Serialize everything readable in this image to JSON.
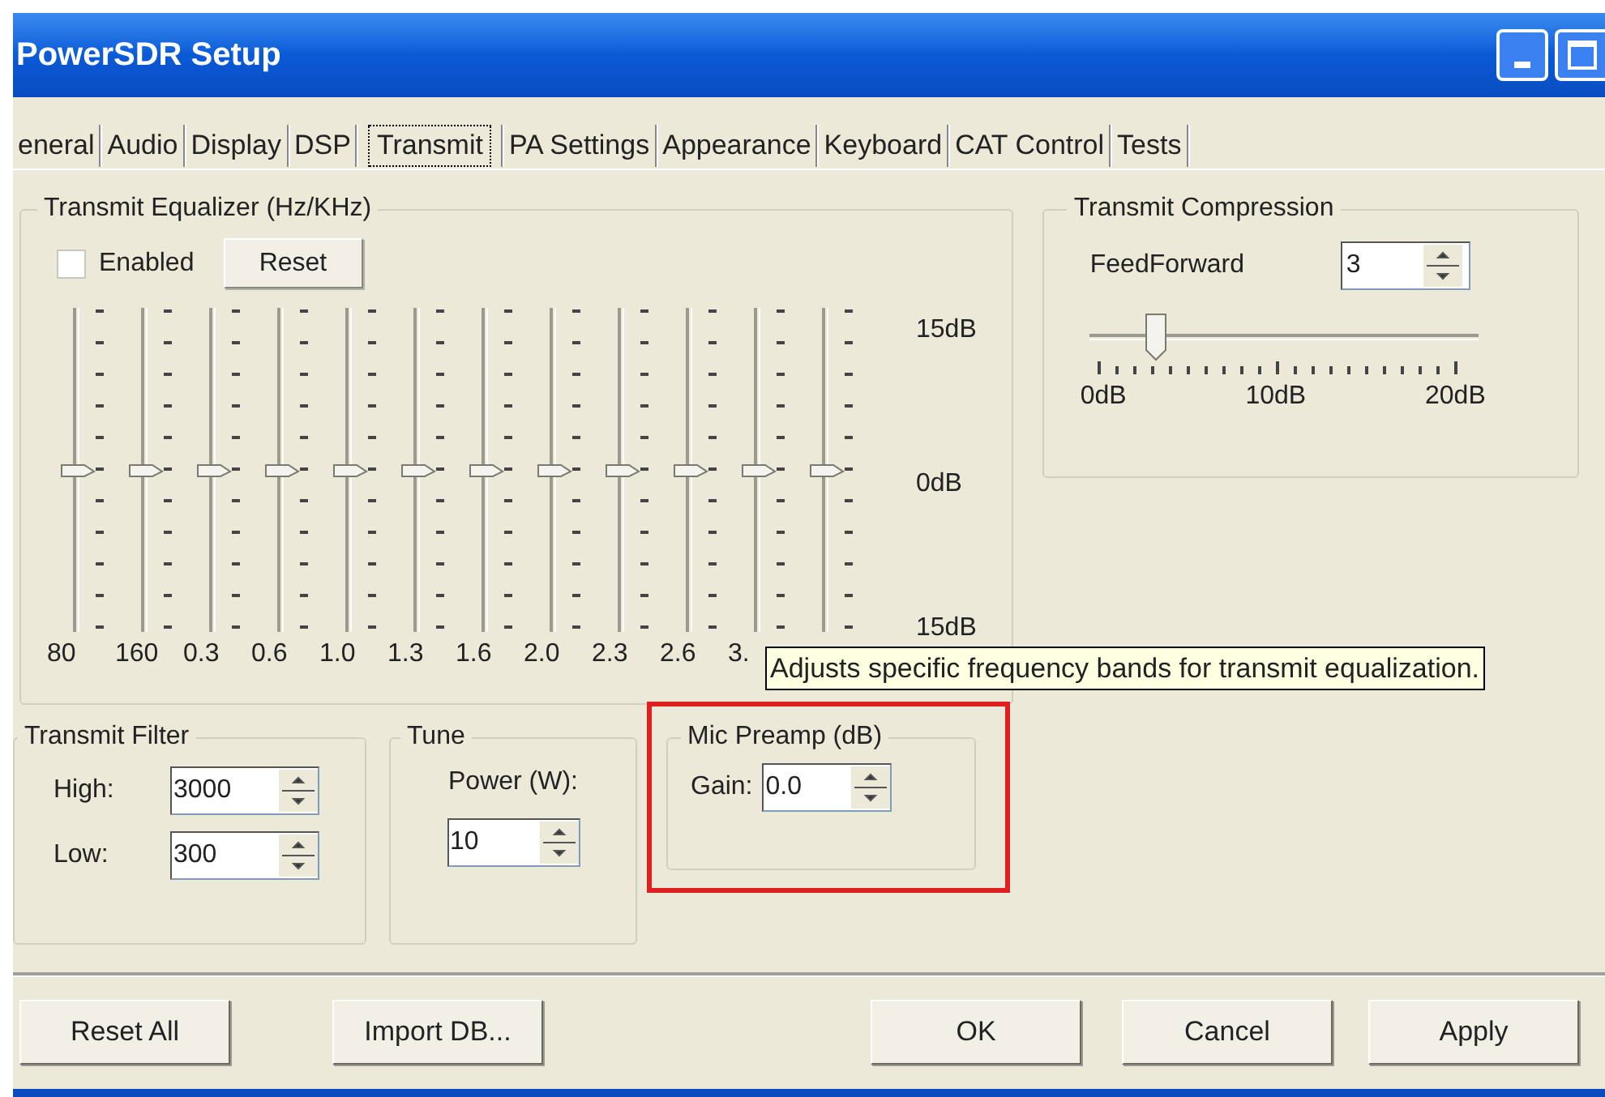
{
  "window": {
    "title": "PowerSDR Setup"
  },
  "tabs": [
    {
      "label": "eneral",
      "selected": false
    },
    {
      "label": "Audio",
      "selected": false
    },
    {
      "label": "Display",
      "selected": false
    },
    {
      "label": "DSP",
      "selected": false
    },
    {
      "label": "Transmit",
      "selected": true
    },
    {
      "label": "PA Settings",
      "selected": false
    },
    {
      "label": "Appearance",
      "selected": false
    },
    {
      "label": "Keyboard",
      "selected": false
    },
    {
      "label": "CAT Control",
      "selected": false
    },
    {
      "label": "Tests",
      "selected": false
    }
  ],
  "equalizer": {
    "title": "Transmit Equalizer (Hz/KHz)",
    "enabled": {
      "label": "Enabled",
      "checked": false
    },
    "reset_button": "Reset",
    "scale": [
      "15dB",
      "0dB",
      "15dB"
    ],
    "bands": [
      {
        "label": "80",
        "level": 0.5
      },
      {
        "label": "160",
        "level": 0.5
      },
      {
        "label": "0.3",
        "level": 0.5
      },
      {
        "label": "0.6",
        "level": 0.5
      },
      {
        "label": "1.0",
        "level": 0.5
      },
      {
        "label": "1.3",
        "level": 0.5
      },
      {
        "label": "1.6",
        "level": 0.5
      },
      {
        "label": "2.0",
        "level": 0.5
      },
      {
        "label": "2.3",
        "level": 0.5
      },
      {
        "label": "2.6",
        "level": 0.5
      },
      {
        "label": "3.",
        "level": 0.5
      },
      {
        "level": 0.5
      }
    ]
  },
  "compression": {
    "title": "Transmit Compression",
    "feedforward": {
      "label": "FeedForward",
      "value": "3"
    },
    "slider": {
      "level": 0.15
    },
    "scale": [
      "0dB",
      "10dB",
      "20dB"
    ]
  },
  "tooltip": "Adjusts specific frequency bands for transmit equalization.",
  "transmit_filter": {
    "title": "Transmit Filter",
    "fields": [
      {
        "label": "High:",
        "value": "3000"
      },
      {
        "label": "Low:",
        "value": "300"
      }
    ]
  },
  "tune": {
    "title": "Tune",
    "label": "Power (W):",
    "value": "10"
  },
  "mic_preamp": {
    "title": "Mic Preamp (dB)",
    "label": "Gain:",
    "value": "0.0",
    "highlighted": true
  },
  "buttons": [
    "Reset All",
    "Import DB...",
    "OK",
    "Cancel",
    "Apply"
  ]
}
